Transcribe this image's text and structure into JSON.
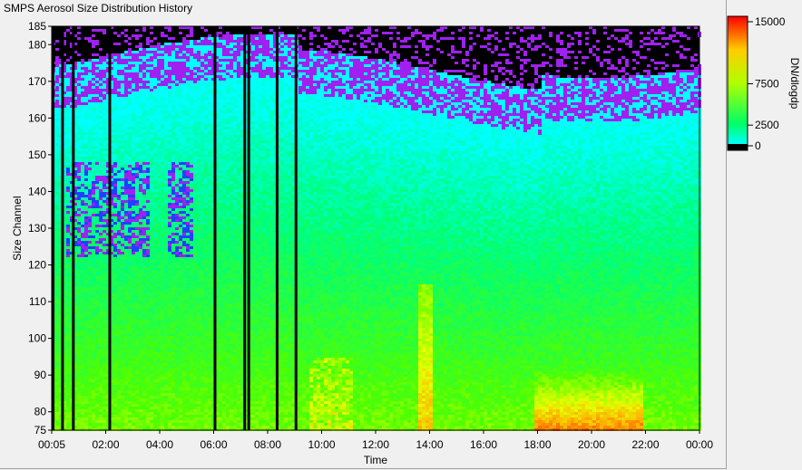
{
  "window": {
    "title": "SMPS Aerosol Size Distribution History"
  },
  "chart_data": {
    "type": "heatmap",
    "title": "SMPS Aerosol Size Distribution History",
    "xlabel": "Time",
    "ylabel": "Size Channel",
    "x_ticks": [
      "00:05",
      "02:00",
      "04:00",
      "06:00",
      "08:00",
      "10:00",
      "12:00",
      "14:00",
      "16:00",
      "18:00",
      "20:00",
      "22:00",
      "00:00"
    ],
    "y_ticks": [
      75,
      80,
      90,
      100,
      110,
      120,
      130,
      140,
      150,
      160,
      170,
      180,
      185
    ],
    "ylim": [
      75,
      185
    ],
    "colorbar": {
      "label": "DN/dlogdp",
      "ticks": [
        15000,
        7500,
        2500,
        0
      ],
      "tick_labels": [
        "15000",
        "7500",
        "2500",
        "0"
      ],
      "range": [
        0,
        15000
      ]
    },
    "gaps_hours": [
      0.0,
      0.35,
      0.75,
      2.1,
      6.0,
      7.1,
      7.25,
      8.3,
      9.0
    ],
    "colors": {
      "background": "#f0f0f0",
      "empty": "#000000",
      "low": "#00ffff",
      "mid": "#00ff00",
      "high": "#ffff00",
      "peak": "#ff0000",
      "trace": "#a020f0"
    }
  }
}
